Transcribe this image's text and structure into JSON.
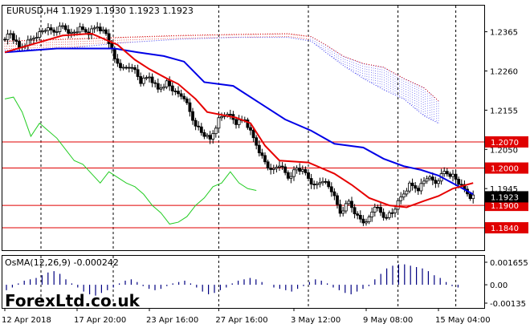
{
  "chart_data": {
    "type": "candlestick",
    "symbol_header": "EURUSD,H4  1.1929 1.1930 1.1923 1.1923",
    "main_panel": {
      "ylim": [
        1.178,
        1.2435
      ],
      "y_ticks": [
        "1.2365",
        "1.2260",
        "1.2155",
        "1.2050",
        "1.1945"
      ],
      "current_price": "1.1923",
      "levels": [
        {
          "value": 1.207,
          "label": "1.2070"
        },
        {
          "value": 1.2,
          "label": "1.2000"
        },
        {
          "value": 1.19,
          "label": "1.1900"
        },
        {
          "value": 1.184,
          "label": "1.1840"
        }
      ],
      "price_path": [
        [
          0,
          1.2345
        ],
        [
          6,
          1.236
        ],
        [
          12,
          1.232
        ],
        [
          18,
          1.2338
        ],
        [
          24,
          1.2356
        ],
        [
          30,
          1.2372
        ],
        [
          36,
          1.2365
        ],
        [
          42,
          1.238
        ],
        [
          48,
          1.236
        ],
        [
          54,
          1.2372
        ],
        [
          60,
          1.2362
        ],
        [
          66,
          1.238
        ],
        [
          72,
          1.236
        ],
        [
          78,
          1.229
        ],
        [
          84,
          1.2265
        ],
        [
          90,
          1.2275
        ],
        [
          96,
          1.223
        ],
        [
          102,
          1.2245
        ],
        [
          108,
          1.221
        ],
        [
          114,
          1.223
        ],
        [
          120,
          1.22
        ],
        [
          126,
          1.219
        ],
        [
          132,
          1.213
        ],
        [
          138,
          1.2095
        ],
        [
          144,
          1.2075
        ],
        [
          150,
          1.213
        ],
        [
          156,
          1.215
        ],
        [
          162,
          1.212
        ],
        [
          168,
          1.213
        ],
        [
          174,
          1.208
        ],
        [
          180,
          1.203
        ],
        [
          186,
          1.199
        ],
        [
          192,
          1.201
        ],
        [
          198,
          1.1975
        ],
        [
          204,
          1.2
        ],
        [
          210,
          1.1985
        ],
        [
          216,
          1.195
        ],
        [
          222,
          1.197
        ],
        [
          228,
          1.194
        ],
        [
          234,
          1.188
        ],
        [
          240,
          1.191
        ],
        [
          246,
          1.187
        ],
        [
          252,
          1.185
        ],
        [
          258,
          1.19
        ],
        [
          264,
          1.187
        ],
        [
          270,
          1.188
        ],
        [
          276,
          1.192
        ],
        [
          282,
          1.1955
        ],
        [
          288,
          1.1945
        ],
        [
          294,
          1.1975
        ],
        [
          300,
          1.196
        ],
        [
          306,
          1.199
        ],
        [
          312,
          1.198
        ],
        [
          318,
          1.195
        ],
        [
          324,
          1.1923
        ]
      ],
      "tenkan_line": [
        [
          0,
          1.231
        ],
        [
          40,
          1.2355
        ],
        [
          60,
          1.236
        ],
        [
          78,
          1.233
        ],
        [
          90,
          1.229
        ],
        [
          100,
          1.2265
        ],
        [
          112,
          1.224
        ],
        [
          120,
          1.2225
        ],
        [
          132,
          1.2185
        ],
        [
          140,
          1.215
        ],
        [
          160,
          1.2135
        ],
        [
          170,
          1.212
        ],
        [
          180,
          1.206
        ],
        [
          190,
          1.202
        ],
        [
          210,
          1.2015
        ],
        [
          228,
          1.1985
        ],
        [
          240,
          1.1955
        ],
        [
          252,
          1.192
        ],
        [
          266,
          1.19
        ],
        [
          278,
          1.1895
        ],
        [
          290,
          1.1912
        ],
        [
          300,
          1.1925
        ],
        [
          310,
          1.1945
        ],
        [
          324,
          1.196
        ]
      ],
      "kijun_line": [
        [
          0,
          1.231
        ],
        [
          36,
          1.232
        ],
        [
          76,
          1.232
        ],
        [
          92,
          1.231
        ],
        [
          110,
          1.23
        ],
        [
          124,
          1.2285
        ],
        [
          138,
          1.223
        ],
        [
          158,
          1.222
        ],
        [
          176,
          1.2175
        ],
        [
          194,
          1.213
        ],
        [
          212,
          1.21
        ],
        [
          228,
          1.2065
        ],
        [
          248,
          1.2055
        ],
        [
          262,
          1.2025
        ],
        [
          276,
          1.2005
        ],
        [
          288,
          1.1995
        ],
        [
          300,
          1.198
        ],
        [
          312,
          1.1955
        ],
        [
          324,
          1.193
        ]
      ],
      "chikou_span": [
        [
          0,
          1.2185
        ],
        [
          6,
          1.219
        ],
        [
          12,
          1.215
        ],
        [
          18,
          1.2085
        ],
        [
          24,
          1.212
        ],
        [
          30,
          1.21
        ],
        [
          36,
          1.208
        ],
        [
          42,
          1.205
        ],
        [
          48,
          1.202
        ],
        [
          54,
          1.201
        ],
        [
          60,
          1.1985
        ],
        [
          66,
          1.196
        ],
        [
          72,
          1.199
        ],
        [
          78,
          1.1975
        ],
        [
          84,
          1.196
        ],
        [
          90,
          1.195
        ],
        [
          96,
          1.193
        ],
        [
          102,
          1.19
        ],
        [
          108,
          1.188
        ],
        [
          114,
          1.185
        ],
        [
          120,
          1.1855
        ],
        [
          126,
          1.187
        ],
        [
          132,
          1.19
        ],
        [
          138,
          1.192
        ],
        [
          144,
          1.195
        ],
        [
          150,
          1.196
        ],
        [
          156,
          1.199
        ],
        [
          162,
          1.196
        ],
        [
          168,
          1.1945
        ],
        [
          174,
          1.194
        ]
      ],
      "cloud_upper": [
        [
          0,
          1.234
        ],
        [
          40,
          1.2345
        ],
        [
          80,
          1.235
        ],
        [
          120,
          1.2355
        ],
        [
          160,
          1.2358
        ],
        [
          196,
          1.236
        ],
        [
          212,
          1.2352
        ],
        [
          222,
          1.233
        ],
        [
          234,
          1.23
        ],
        [
          248,
          1.228
        ],
        [
          262,
          1.227
        ],
        [
          276,
          1.224
        ],
        [
          290,
          1.2215
        ],
        [
          300,
          1.218
        ]
      ],
      "cloud_lower": [
        [
          0,
          1.2315
        ],
        [
          40,
          1.232
        ],
        [
          80,
          1.2335
        ],
        [
          120,
          1.2345
        ],
        [
          160,
          1.235
        ],
        [
          196,
          1.235
        ],
        [
          212,
          1.234
        ],
        [
          222,
          1.231
        ],
        [
          234,
          1.2275
        ],
        [
          248,
          1.224
        ],
        [
          262,
          1.221
        ],
        [
          276,
          1.2185
        ],
        [
          290,
          1.214
        ],
        [
          300,
          1.212
        ]
      ]
    },
    "indicator_panel": {
      "label": "OsMA(12,26,9) -0.000242",
      "y_ticks": [
        "0.001655",
        "0.00",
        "-0.00135"
      ],
      "ylim": [
        -0.00135,
        0.001655
      ],
      "values": [
        -0.0004,
        -0.0002,
        0.0001,
        0.0003,
        0.0004,
        0.0005,
        0.0007,
        0.0009,
        0.001,
        0.0008,
        0.0004,
        0.0001,
        -0.0002,
        -0.0005,
        -0.0007,
        -0.0008,
        -0.0006,
        -0.0004,
        -0.0002,
        0.0001,
        0.0003,
        0.0004,
        0.0002,
        -0.0001,
        -0.0003,
        -0.0004,
        -0.0003,
        -0.0001,
        0.0001,
        0.0002,
        0.0003,
        0.0001,
        -0.0002,
        -0.0005,
        -0.0007,
        -0.0006,
        -0.0004,
        -0.0002,
        0.0001,
        0.0003,
        0.0004,
        0.0005,
        0.0004,
        0.0002,
        0.0,
        -0.0002,
        -0.0003,
        -0.0004,
        -0.0005,
        -0.0003,
        -0.0001,
        0.0002,
        0.0004,
        0.0003,
        0.0001,
        -0.0002,
        -0.0004,
        -0.0006,
        -0.0007,
        -0.0005,
        -0.0003,
        -0.0001,
        0.0004,
        0.0008,
        0.0012,
        0.0014,
        0.0015,
        0.0015,
        0.0014,
        0.0013,
        0.0012,
        0.001,
        0.0007,
        0.0005,
        0.0002,
        -0.0001,
        -0.0002
      ]
    },
    "x_tick_labels": [
      "12 Apr 2018",
      "17 Apr 20:00",
      "23 Apr 16:00",
      "27 Apr 16:00",
      "3 May 12:00",
      "9 May 08:00",
      "15 May 04:00"
    ],
    "x_tick_positions": [
      0,
      50,
      100,
      148,
      200,
      250,
      300
    ],
    "vertical_separators": [
      25,
      75,
      148,
      210,
      272,
      312
    ],
    "colors": {
      "candles": "#000000",
      "tenkan": "#e60000",
      "kijun": "#0000e6",
      "chikou": "#22cc22",
      "cloud_red": "#d40000",
      "cloud_blue": "#3a3aee",
      "level_line": "#e00000",
      "level_tag": "#e00000",
      "current_tag": "#000000",
      "histogram": "#000080"
    }
  },
  "watermark": "ForexLtd.co.uk"
}
